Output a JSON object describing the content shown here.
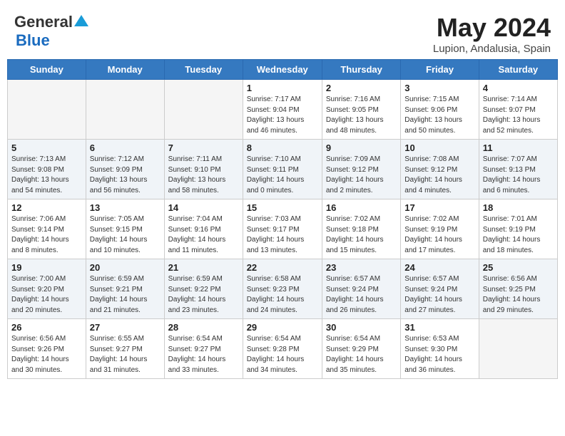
{
  "header": {
    "logo_general": "General",
    "logo_blue": "Blue",
    "month_title": "May 2024",
    "location": "Lupion, Andalusia, Spain"
  },
  "days_of_week": [
    "Sunday",
    "Monday",
    "Tuesday",
    "Wednesday",
    "Thursday",
    "Friday",
    "Saturday"
  ],
  "weeks": [
    {
      "days": [
        {
          "number": "",
          "info": ""
        },
        {
          "number": "",
          "info": ""
        },
        {
          "number": "",
          "info": ""
        },
        {
          "number": "1",
          "info": "Sunrise: 7:17 AM\nSunset: 9:04 PM\nDaylight: 13 hours\nand 46 minutes."
        },
        {
          "number": "2",
          "info": "Sunrise: 7:16 AM\nSunset: 9:05 PM\nDaylight: 13 hours\nand 48 minutes."
        },
        {
          "number": "3",
          "info": "Sunrise: 7:15 AM\nSunset: 9:06 PM\nDaylight: 13 hours\nand 50 minutes."
        },
        {
          "number": "4",
          "info": "Sunrise: 7:14 AM\nSunset: 9:07 PM\nDaylight: 13 hours\nand 52 minutes."
        }
      ]
    },
    {
      "days": [
        {
          "number": "5",
          "info": "Sunrise: 7:13 AM\nSunset: 9:08 PM\nDaylight: 13 hours\nand 54 minutes."
        },
        {
          "number": "6",
          "info": "Sunrise: 7:12 AM\nSunset: 9:09 PM\nDaylight: 13 hours\nand 56 minutes."
        },
        {
          "number": "7",
          "info": "Sunrise: 7:11 AM\nSunset: 9:10 PM\nDaylight: 13 hours\nand 58 minutes."
        },
        {
          "number": "8",
          "info": "Sunrise: 7:10 AM\nSunset: 9:11 PM\nDaylight: 14 hours\nand 0 minutes."
        },
        {
          "number": "9",
          "info": "Sunrise: 7:09 AM\nSunset: 9:12 PM\nDaylight: 14 hours\nand 2 minutes."
        },
        {
          "number": "10",
          "info": "Sunrise: 7:08 AM\nSunset: 9:12 PM\nDaylight: 14 hours\nand 4 minutes."
        },
        {
          "number": "11",
          "info": "Sunrise: 7:07 AM\nSunset: 9:13 PM\nDaylight: 14 hours\nand 6 minutes."
        }
      ]
    },
    {
      "days": [
        {
          "number": "12",
          "info": "Sunrise: 7:06 AM\nSunset: 9:14 PM\nDaylight: 14 hours\nand 8 minutes."
        },
        {
          "number": "13",
          "info": "Sunrise: 7:05 AM\nSunset: 9:15 PM\nDaylight: 14 hours\nand 10 minutes."
        },
        {
          "number": "14",
          "info": "Sunrise: 7:04 AM\nSunset: 9:16 PM\nDaylight: 14 hours\nand 11 minutes."
        },
        {
          "number": "15",
          "info": "Sunrise: 7:03 AM\nSunset: 9:17 PM\nDaylight: 14 hours\nand 13 minutes."
        },
        {
          "number": "16",
          "info": "Sunrise: 7:02 AM\nSunset: 9:18 PM\nDaylight: 14 hours\nand 15 minutes."
        },
        {
          "number": "17",
          "info": "Sunrise: 7:02 AM\nSunset: 9:19 PM\nDaylight: 14 hours\nand 17 minutes."
        },
        {
          "number": "18",
          "info": "Sunrise: 7:01 AM\nSunset: 9:19 PM\nDaylight: 14 hours\nand 18 minutes."
        }
      ]
    },
    {
      "days": [
        {
          "number": "19",
          "info": "Sunrise: 7:00 AM\nSunset: 9:20 PM\nDaylight: 14 hours\nand 20 minutes."
        },
        {
          "number": "20",
          "info": "Sunrise: 6:59 AM\nSunset: 9:21 PM\nDaylight: 14 hours\nand 21 minutes."
        },
        {
          "number": "21",
          "info": "Sunrise: 6:59 AM\nSunset: 9:22 PM\nDaylight: 14 hours\nand 23 minutes."
        },
        {
          "number": "22",
          "info": "Sunrise: 6:58 AM\nSunset: 9:23 PM\nDaylight: 14 hours\nand 24 minutes."
        },
        {
          "number": "23",
          "info": "Sunrise: 6:57 AM\nSunset: 9:24 PM\nDaylight: 14 hours\nand 26 minutes."
        },
        {
          "number": "24",
          "info": "Sunrise: 6:57 AM\nSunset: 9:24 PM\nDaylight: 14 hours\nand 27 minutes."
        },
        {
          "number": "25",
          "info": "Sunrise: 6:56 AM\nSunset: 9:25 PM\nDaylight: 14 hours\nand 29 minutes."
        }
      ]
    },
    {
      "days": [
        {
          "number": "26",
          "info": "Sunrise: 6:56 AM\nSunset: 9:26 PM\nDaylight: 14 hours\nand 30 minutes."
        },
        {
          "number": "27",
          "info": "Sunrise: 6:55 AM\nSunset: 9:27 PM\nDaylight: 14 hours\nand 31 minutes."
        },
        {
          "number": "28",
          "info": "Sunrise: 6:54 AM\nSunset: 9:27 PM\nDaylight: 14 hours\nand 33 minutes."
        },
        {
          "number": "29",
          "info": "Sunrise: 6:54 AM\nSunset: 9:28 PM\nDaylight: 14 hours\nand 34 minutes."
        },
        {
          "number": "30",
          "info": "Sunrise: 6:54 AM\nSunset: 9:29 PM\nDaylight: 14 hours\nand 35 minutes."
        },
        {
          "number": "31",
          "info": "Sunrise: 6:53 AM\nSunset: 9:30 PM\nDaylight: 14 hours\nand 36 minutes."
        },
        {
          "number": "",
          "info": ""
        }
      ]
    }
  ]
}
